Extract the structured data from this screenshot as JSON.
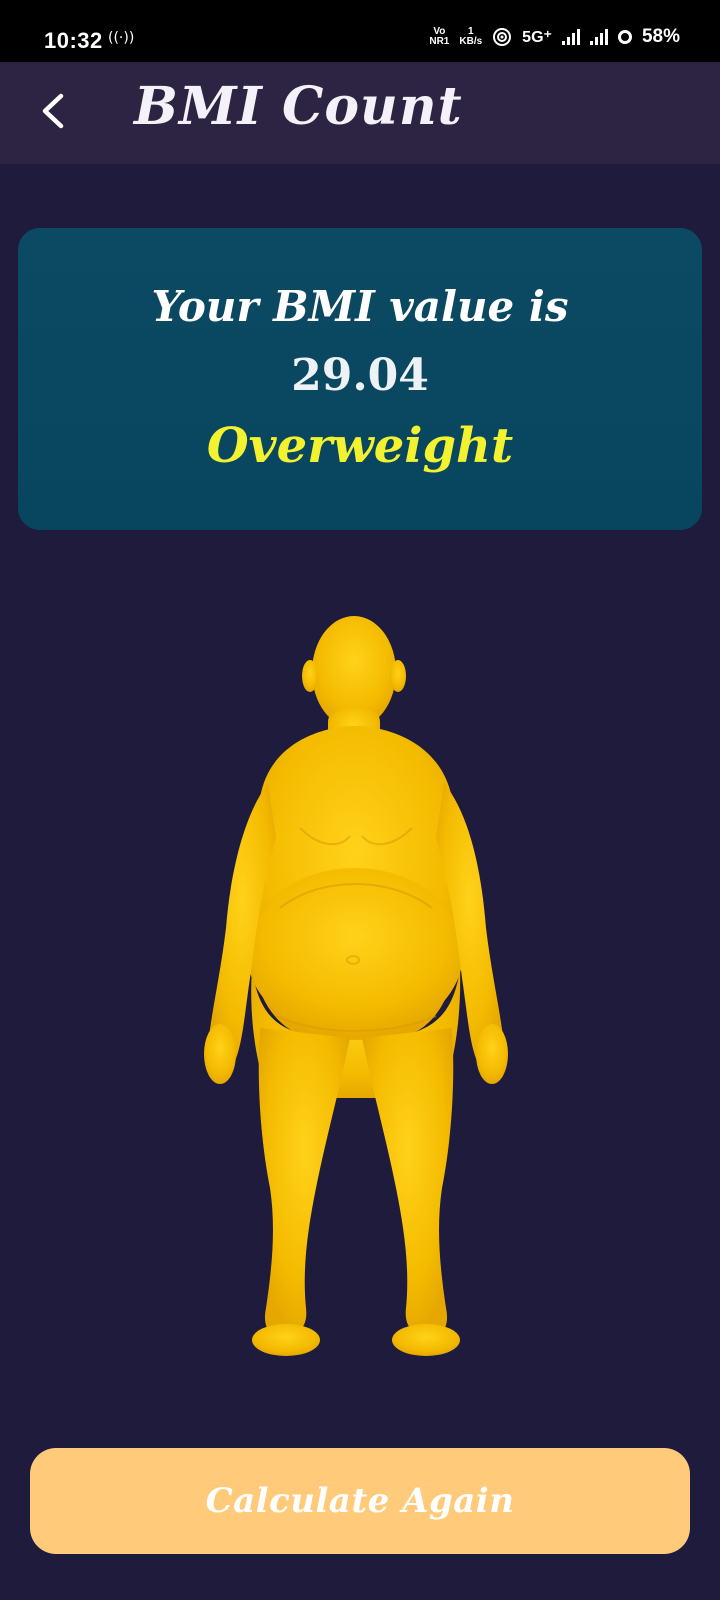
{
  "status_bar": {
    "time": "10:32",
    "network_indicator_top": "Vo",
    "network_indicator_bottom": "NR1",
    "speed_value": "1",
    "speed_unit": "KB/s",
    "network_type": "5G⁺",
    "battery_percent": "58%"
  },
  "app_bar": {
    "title": "BMI Count",
    "back_icon": "chevron-left-icon"
  },
  "result": {
    "heading": "Your BMI value is",
    "value": "29.04",
    "category": "Overweight"
  },
  "actions": {
    "calculate_again_label": "Calculate Again"
  },
  "colors": {
    "background": "#1f1b3d",
    "app_bar": "#2c2442",
    "card": "#0c4a64",
    "category_text": "#f2f230",
    "button": "#ffcb7a",
    "figure": "#f7c200"
  }
}
